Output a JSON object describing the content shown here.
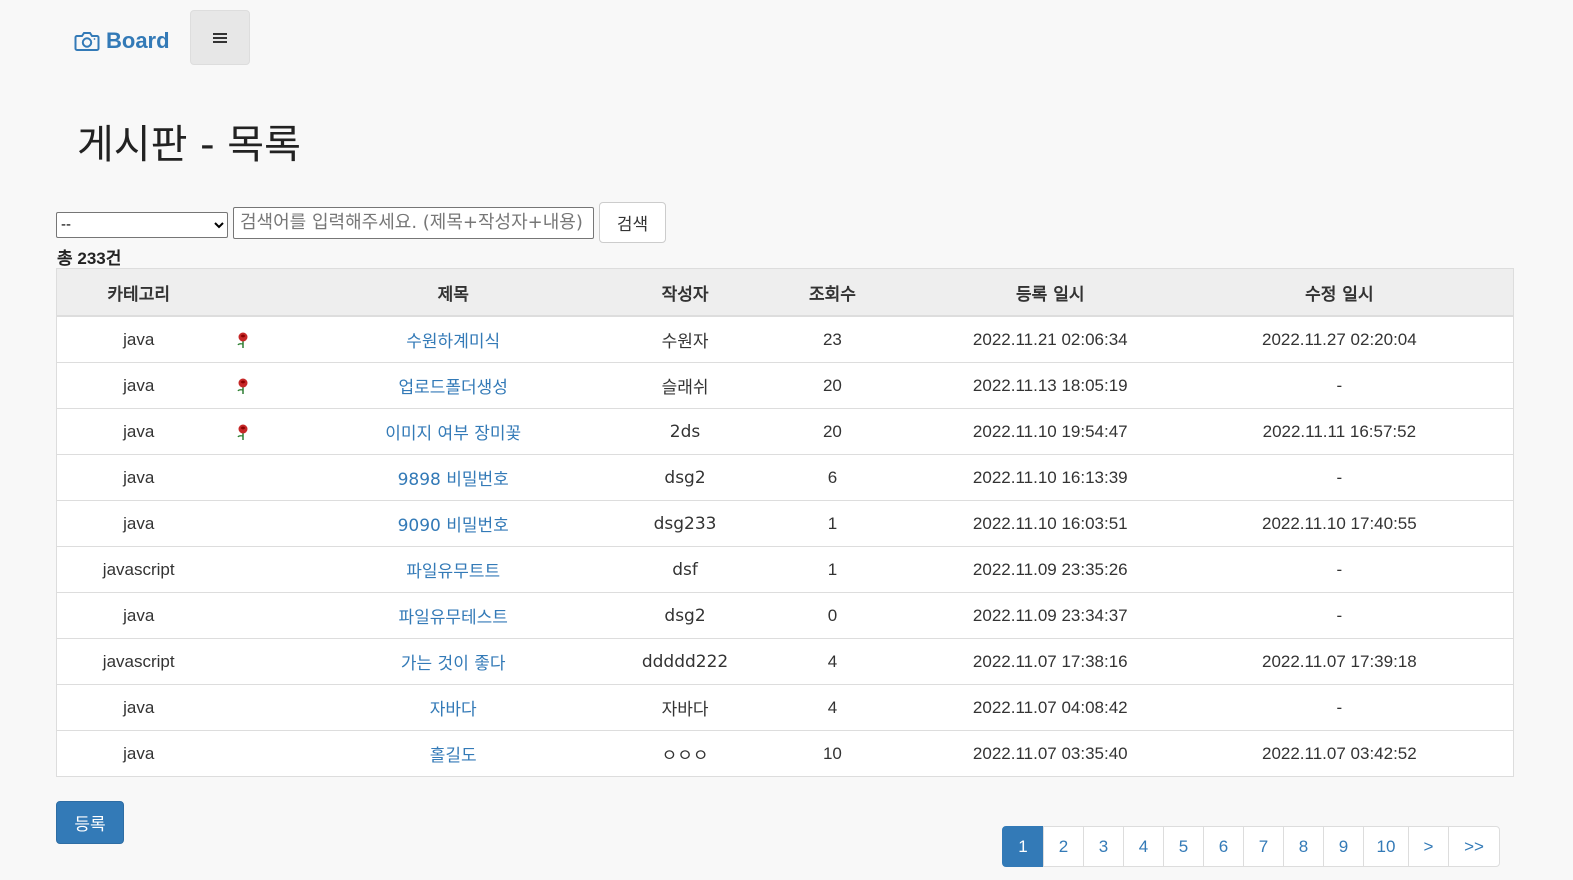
{
  "navbar": {
    "brand": "Board",
    "brand_icon": "camera-icon",
    "toggle_icon": "hamburger-icon"
  },
  "page_title": "게시판 - 목록",
  "search": {
    "category_selected": "--",
    "placeholder": "검색어를 입력해주세요. (제목+작성자+내용)",
    "button_label": "검색"
  },
  "total_text": "총 233건",
  "table": {
    "headers": [
      "카테고리",
      "",
      "제목",
      "작성자",
      "조회수",
      "등록 일시",
      "수정 일시"
    ],
    "rows": [
      {
        "category": "java",
        "has_file": true,
        "title": "수원하계미식",
        "writer": "수원자",
        "views": "23",
        "created": "2022.11.21 02:06:34",
        "modified": "2022.11.27 02:20:04"
      },
      {
        "category": "java",
        "has_file": true,
        "title": "업로드폴더생성",
        "writer": "슬래쉬",
        "views": "20",
        "created": "2022.11.13 18:05:19",
        "modified": "-"
      },
      {
        "category": "java",
        "has_file": true,
        "title": "이미지 여부 장미꽃",
        "writer": "2ds",
        "views": "20",
        "created": "2022.11.10 19:54:47",
        "modified": "2022.11.11 16:57:52"
      },
      {
        "category": "java",
        "has_file": false,
        "title": "9898 비밀번호",
        "writer": "dsg2",
        "views": "6",
        "created": "2022.11.10 16:13:39",
        "modified": "-"
      },
      {
        "category": "java",
        "has_file": false,
        "title": "9090 비밀번호",
        "writer": "dsg233",
        "views": "1",
        "created": "2022.11.10 16:03:51",
        "modified": "2022.11.10 17:40:55"
      },
      {
        "category": "javascript",
        "has_file": false,
        "title": "파일유무트트",
        "writer": "dsf",
        "views": "1",
        "created": "2022.11.09 23:35:26",
        "modified": "-"
      },
      {
        "category": "java",
        "has_file": false,
        "title": "파일유무테스트",
        "writer": "dsg2",
        "views": "0",
        "created": "2022.11.09 23:34:37",
        "modified": "-"
      },
      {
        "category": "javascript",
        "has_file": false,
        "title": "가는 것이 좋다",
        "writer": "ddddd222",
        "views": "4",
        "created": "2022.11.07 17:38:16",
        "modified": "2022.11.07 17:39:18"
      },
      {
        "category": "java",
        "has_file": false,
        "title": "자바다",
        "writer": "자바다",
        "views": "4",
        "created": "2022.11.07 04:08:42",
        "modified": "-"
      },
      {
        "category": "java",
        "has_file": false,
        "title": "홀길도",
        "writer": "ㅇㅇㅇ",
        "views": "10",
        "created": "2022.11.07 03:35:40",
        "modified": "2022.11.07 03:42:52"
      }
    ],
    "file_icon": "rose-icon"
  },
  "write_button": "등록",
  "pagination": {
    "pages": [
      "1",
      "2",
      "3",
      "4",
      "5",
      "6",
      "7",
      "8",
      "9",
      "10",
      ">",
      ">>"
    ],
    "active": "1"
  },
  "colors": {
    "brand": "#337ab7",
    "background": "#f8f8f8",
    "header_bg": "#eeeeee"
  }
}
